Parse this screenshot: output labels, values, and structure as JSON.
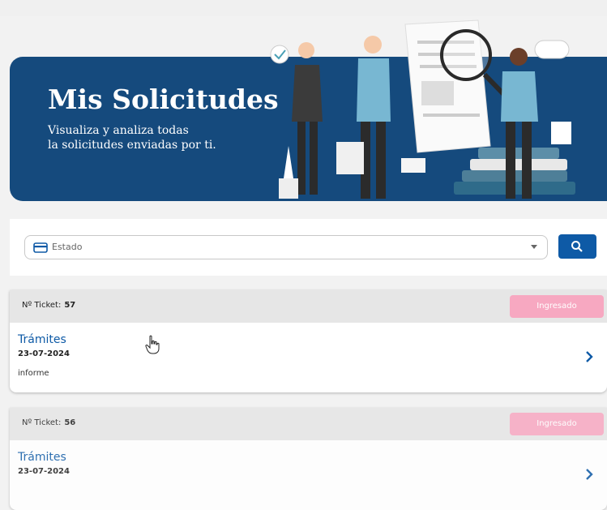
{
  "hero": {
    "title": "Mis Solicitudes",
    "subtitle_line1": "Visualiza y analiza  todas",
    "subtitle_line2": "la solicitudes enviadas por ti."
  },
  "search": {
    "placeholder": "Estado",
    "button_icon": "search-icon"
  },
  "tickets": [
    {
      "label": "Nº Ticket:",
      "number": "57",
      "status": "Ingresado",
      "title": "Trámites",
      "date": "23-07-2024",
      "description": "informe"
    },
    {
      "label": "Nº Ticket:",
      "number": "56",
      "status": "Ingresado",
      "title": "Trámites",
      "date": "23-07-2024",
      "description": ""
    }
  ],
  "colors": {
    "hero_bg": "#154a7d",
    "accent": "#0e5aa6",
    "status_pill": "#f7a8c1"
  }
}
